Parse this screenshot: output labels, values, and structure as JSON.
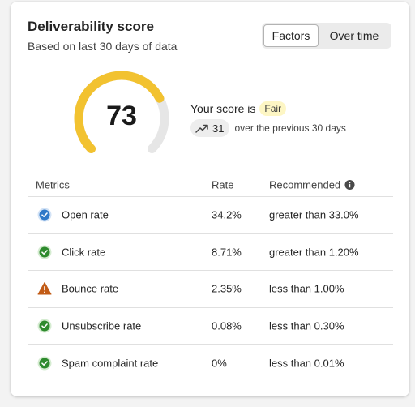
{
  "header": {
    "title": "Deliverability score",
    "subtitle": "Based on last 30 days of data"
  },
  "view_toggle": {
    "options": [
      "Factors",
      "Over time"
    ],
    "selected": "Factors"
  },
  "score": {
    "value": "73",
    "value_fraction": 0.73,
    "prefix": "Your score is",
    "rating": "Fair",
    "change": "31",
    "change_suffix": "over the previous 30 days"
  },
  "colors": {
    "gauge_fill": "#f2c230",
    "gauge_track": "#e6e6e6",
    "badge_fair": "#fdf6c4",
    "status_info": "#2f78c8",
    "status_success": "#2e8b2e",
    "status_warning": "#c25b16"
  },
  "metrics": {
    "columns": [
      "Metrics",
      "Rate",
      "Recommended"
    ],
    "rows": [
      {
        "name": "Open rate",
        "rate": "34.2%",
        "recommended": "greater than 33.0%",
        "status": "info",
        "icon": "checkmark-circle-blue-icon"
      },
      {
        "name": "Click rate",
        "rate": "8.71%",
        "recommended": "greater than 1.20%",
        "status": "success",
        "icon": "checkmark-circle-green-icon"
      },
      {
        "name": "Bounce rate",
        "rate": "2.35%",
        "recommended": "less than 1.00%",
        "status": "warning",
        "icon": "warning-triangle-icon"
      },
      {
        "name": "Unsubscribe rate",
        "rate": "0.08%",
        "recommended": "less than 0.30%",
        "status": "success",
        "icon": "checkmark-circle-green-icon"
      },
      {
        "name": "Spam complaint rate",
        "rate": "0%",
        "recommended": "less than 0.01%",
        "status": "success",
        "icon": "checkmark-circle-green-icon"
      }
    ]
  }
}
